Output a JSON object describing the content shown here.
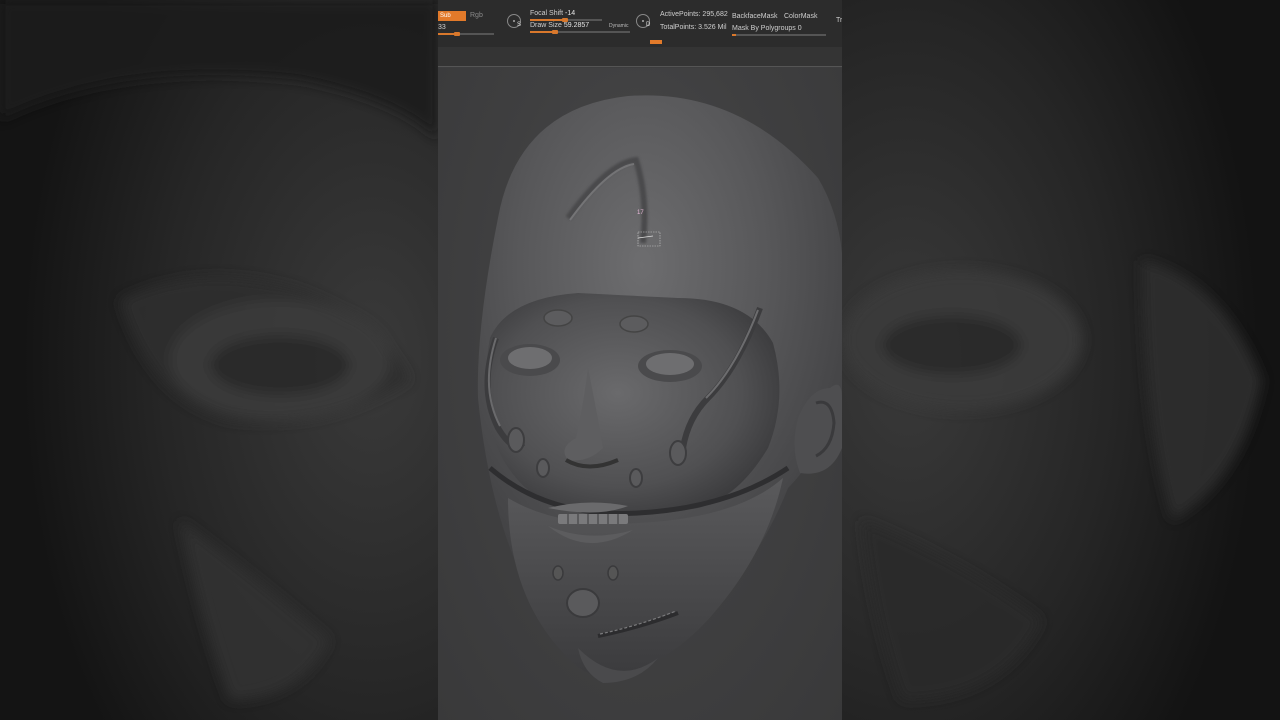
{
  "toolbar": {
    "sub_button_label": "Sub",
    "rgb_label": "Rgb",
    "left_value": "33",
    "focal_shift_label": "Focal Shift",
    "focal_shift_value": "-14",
    "draw_size_label": "Draw Size",
    "draw_size_value": "59.2857",
    "dynamic_label": "Dynamic",
    "active_points_label": "ActivePoints:",
    "active_points_value": "295,682",
    "total_points_label": "TotalPoints:",
    "total_points_value": "3.526 Mil",
    "backface_mask_label": "BackfaceMask",
    "color_mask_label": "ColorMask",
    "mask_by_polygroups_label": "Mask By Polygroups",
    "mask_by_polygroups_value": "0",
    "truncated_right_label": "Tr",
    "dial_s_letter": "S",
    "dial_d_letter": "D"
  },
  "viewport": {
    "cursor_label": "17"
  },
  "colors": {
    "accent": "#e27a2a",
    "toolbar_bg": "#2c2c2c",
    "canvas_bg": "#3d3d3e",
    "outer_bg": "#141414"
  }
}
